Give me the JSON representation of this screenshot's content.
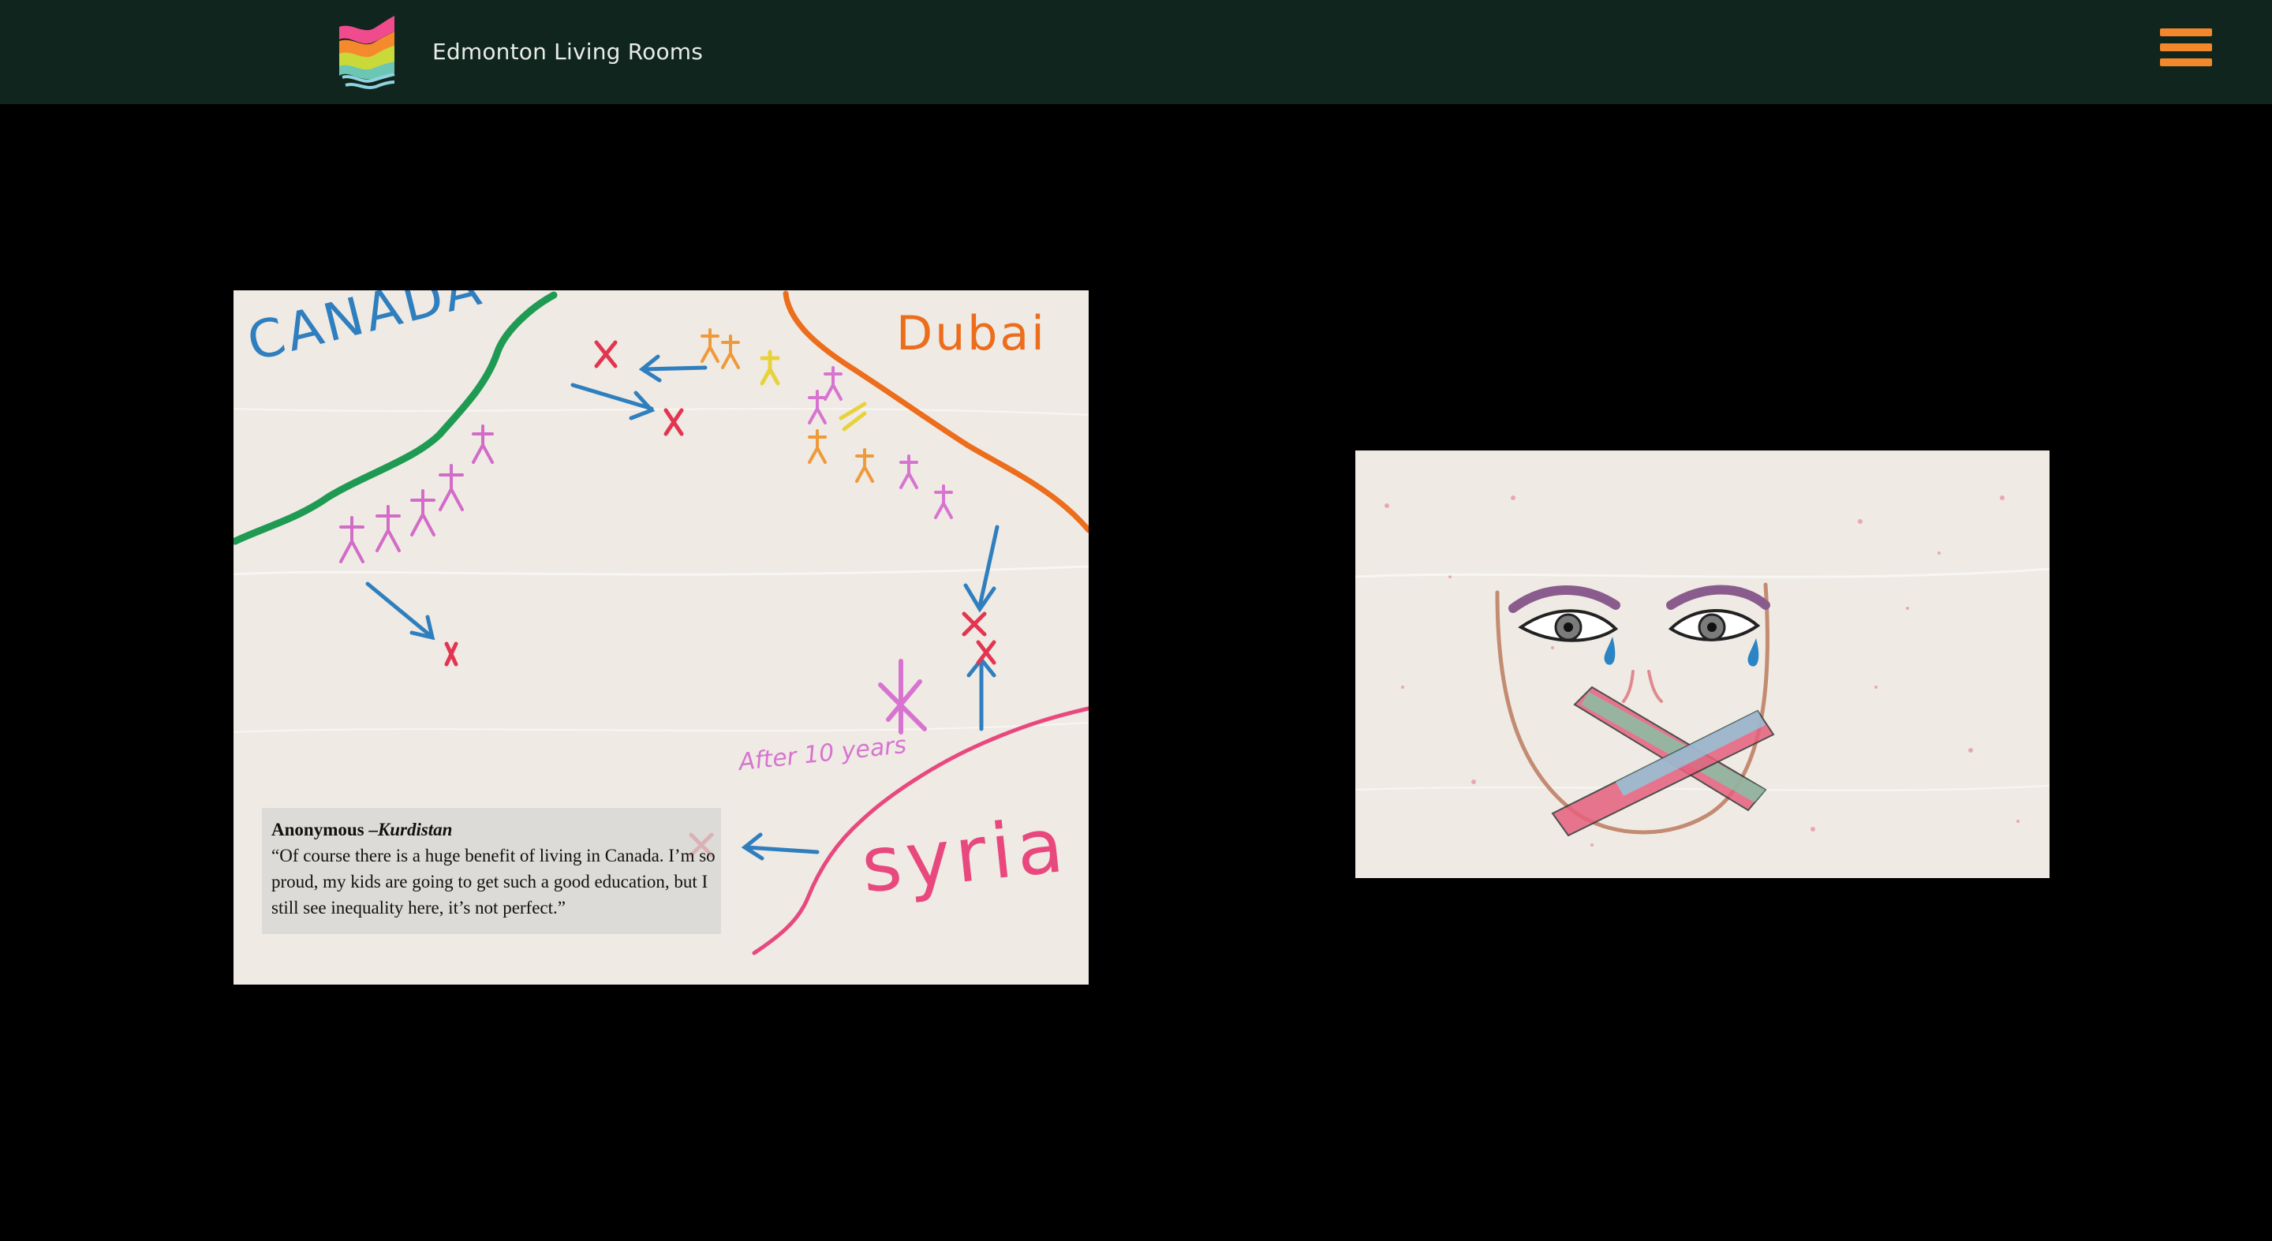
{
  "header": {
    "site_title": "Edmonton Living Rooms",
    "logo_icon": "edmonton-living-rooms-logo",
    "menu_icon": "hamburger-menu-icon",
    "background": "#10251d",
    "accent": "#f3872c"
  },
  "artworks": [
    {
      "id": "map-drawing",
      "labels": {
        "canada": "CANADA",
        "dubai": "Dubai",
        "syria": "syria",
        "after": "After 10 years"
      },
      "caption": {
        "author": "Anonymous",
        "separator": " –",
        "origin": "Kurdistan",
        "quote": "“Of course there is a huge benefit of living in Canada. I’m so proud, my kids are going to get such a good education, but I still see inequality here, it’s not perfect.”"
      }
    },
    {
      "id": "face-drawing",
      "icon": "taped-mouth-face-drawing"
    }
  ]
}
